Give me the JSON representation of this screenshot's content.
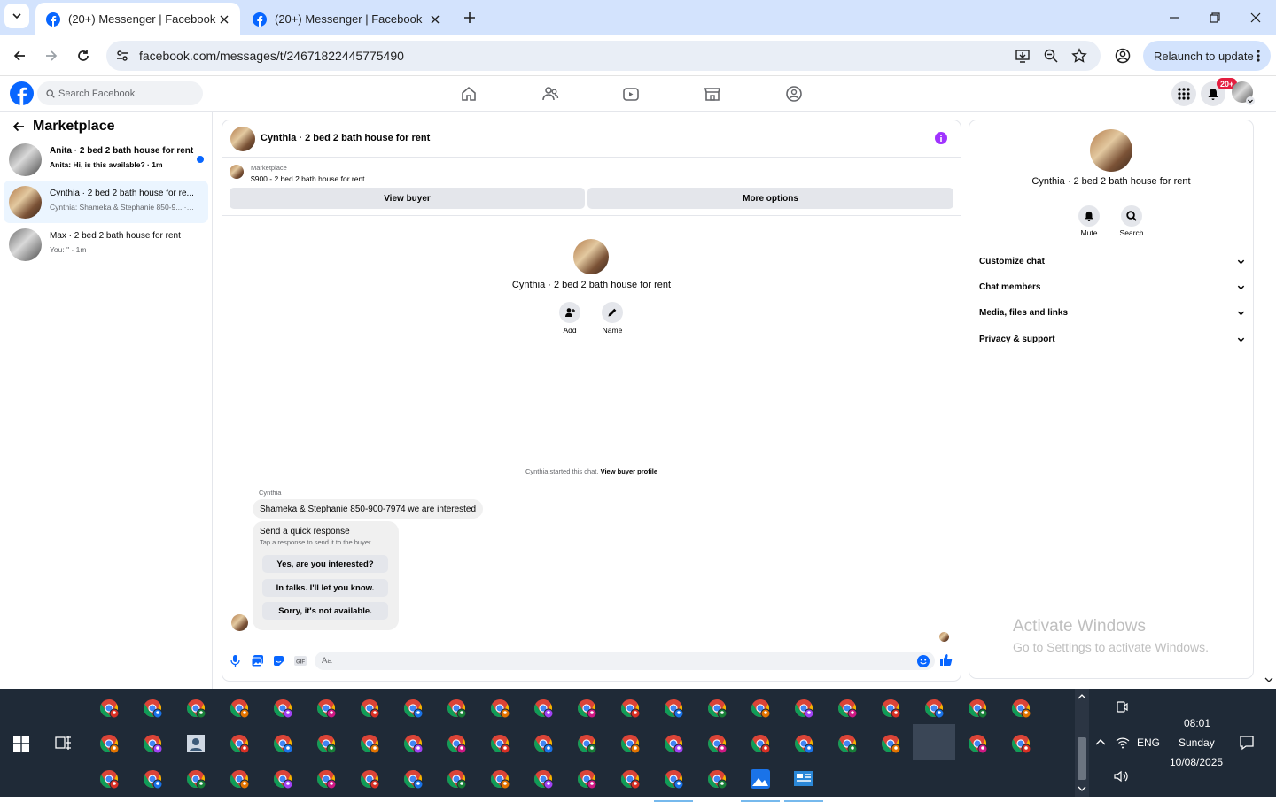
{
  "browser": {
    "tabs": [
      {
        "title": "(20+) Messenger | Facebook",
        "active": true
      },
      {
        "title": "(20+) Messenger | Facebook",
        "active": false
      }
    ],
    "url": "facebook.com/messages/t/24671822445775490",
    "relaunch_label": "Relaunch to update"
  },
  "fb": {
    "search_placeholder": "Search Facebook",
    "notification_badge": "20+",
    "brand_color": "#0866ff"
  },
  "sidebar": {
    "title": "Marketplace",
    "conversations": [
      {
        "name": "Anita · 2 bed 2 bath house for rent",
        "preview": "Anita: Hi, is this available? · 1m",
        "unread": true
      },
      {
        "name": "Cynthia · 2 bed 2 bath house for re...",
        "preview": "Cynthia: Shameka & Stephanie 850-9... · 1m",
        "selected": true
      },
      {
        "name": "Max · 2 bed 2 bath house for rent",
        "preview": "You: \" · 1m"
      }
    ]
  },
  "chat": {
    "header_title": "Cynthia · 2 bed 2 bath house for rent",
    "marketplace_label": "Marketplace",
    "listing_line": "$900 - 2 bed 2 bath house for rent",
    "view_buyer": "View buyer",
    "more_options": "More options",
    "profile_name": "Cynthia · 2 bed 2 bath house for rent",
    "add_label": "Add",
    "name_label": "Name",
    "started_text": "Cynthia started this chat.",
    "view_buyer_profile": "View buyer profile",
    "sender": "Cynthia",
    "message": "Shameka & Stephanie 850-900-7974  we are interested",
    "quick_title": "Send a quick response",
    "quick_sub": "Tap a response to send it to the buyer.",
    "quick_responses": [
      "Yes, are you interested?",
      "In talks. I'll let you know.",
      "Sorry, it's not available."
    ],
    "composer_placeholder": "Aa"
  },
  "info": {
    "name": "Cynthia · 2 bed 2 bath house for rent",
    "mute": "Mute",
    "search": "Search",
    "sections": [
      "Customize chat",
      "Chat members",
      "Media, files and links",
      "Privacy & support"
    ]
  },
  "watermark": {
    "title": "Activate Windows",
    "sub": "Go to Settings to activate Windows."
  },
  "taskbar": {
    "lang": "ENG",
    "time": "08:01",
    "day": "Sunday",
    "date": "10/08/2025"
  }
}
